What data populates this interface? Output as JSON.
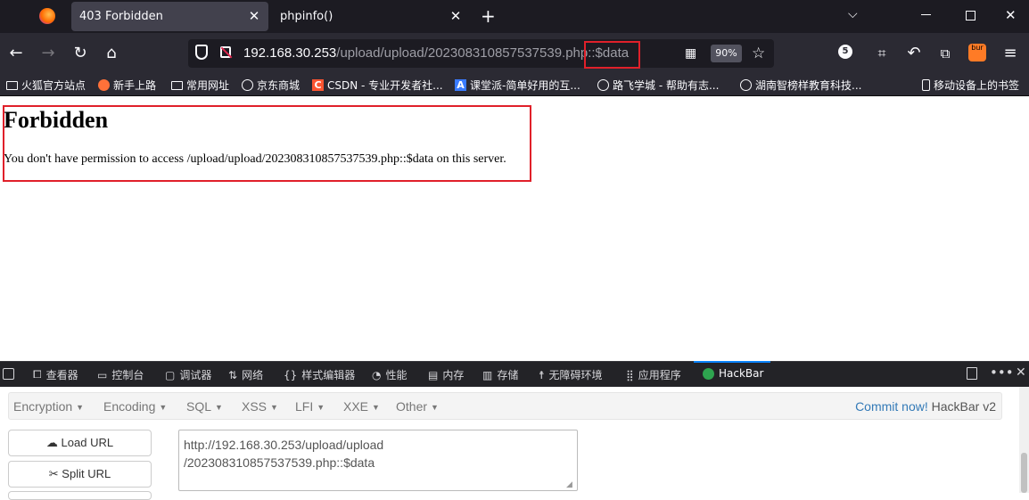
{
  "browser": {
    "tabs": [
      {
        "title": "403 Forbidden",
        "active": true
      },
      {
        "title": "phpinfo()",
        "active": false
      }
    ],
    "new_tab_icon": "plus-icon",
    "url_host": "192.168.30.253",
    "url_path": "/upload/upload/202308310857537539.php::$data",
    "zoom": "90%",
    "extension_badge": "5",
    "bookmarks": [
      "火狐官方站点",
      "新手上路",
      "常用网址",
      "京东商城",
      "CSDN - 专业开发者社...",
      "课堂派-简单好用的互...",
      "路飞学城 - 帮助有志...",
      "湖南智榜样教育科技...",
      "移动设备上的书签"
    ]
  },
  "page": {
    "heading": "Forbidden",
    "message": "You don't have permission to access /upload/upload/202308310857537539.php::$data on this server."
  },
  "devtools": {
    "tabs": [
      "查看器",
      "控制台",
      "调试器",
      "网络",
      "样式编辑器",
      "性能",
      "内存",
      "存储",
      "无障碍环境",
      "应用程序",
      "HackBar"
    ],
    "active_tab": "HackBar"
  },
  "hackbar": {
    "menus": [
      "Encryption",
      "Encoding",
      "SQL",
      "XSS",
      "LFI",
      "XXE",
      "Other"
    ],
    "commit_link": "Commit now!",
    "commit_suffix": " HackBar v2",
    "load_url": "Load URL",
    "split_url": "Split URL",
    "url_line1": "http://192.168.30.253/upload/upload",
    "url_line2": "/202308310857537539.php::$data"
  },
  "colors": {
    "annotation_red": "#e0202a",
    "tabbar_bg": "#1c1b22",
    "toolbar_bg": "#2b2a33",
    "link_blue": "#337ab7"
  }
}
